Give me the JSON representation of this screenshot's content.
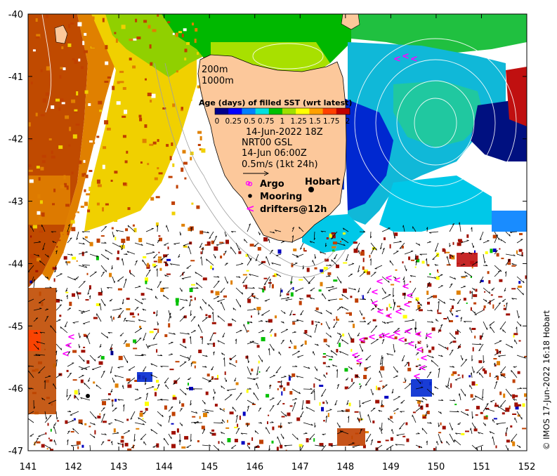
{
  "map": {
    "lon_ticks": [
      "141",
      "142",
      "143",
      "144",
      "145",
      "146",
      "147",
      "148",
      "149",
      "150",
      "151",
      "152"
    ],
    "lat_ticks": [
      "-40",
      "-41",
      "-42",
      "-43",
      "-44",
      "-45",
      "-46",
      "-47"
    ],
    "lon_range": [
      141,
      152
    ],
    "lat_range": [
      -47,
      -40
    ]
  },
  "isobaths": {
    "label_200": "200m",
    "label_1000": "1000m"
  },
  "colorbar": {
    "title": "Age (days) of filled SST (wrt latest)",
    "ticks": [
      "0",
      "0.25",
      "0.5",
      "0.75",
      "1",
      "1.25",
      "1.5",
      "1.75",
      "2"
    ],
    "colors": [
      "#00008b",
      "#0000ff",
      "#0080ff",
      "#00e0e0",
      "#00c000",
      "#a0e000",
      "#ffff00",
      "#ffa000",
      "#ff4000",
      "#c00000"
    ]
  },
  "annotations": {
    "sst_time": "14-Jun-2022 18Z",
    "current_source": "NRT00 GSL",
    "current_time": "14-Jun 06:00Z",
    "scale_text": "0.5m/s (1kt 24h)"
  },
  "legend": {
    "argo": "Argo",
    "mooring": "Mooring",
    "drifters": "drifters@12h",
    "argo_symbol": "o",
    "mooring_symbol": "●",
    "drifter_symbol": "<"
  },
  "places": {
    "hobart": "Hobart"
  },
  "credit": "© IMOS 17-Jun-2022 16:18 Hobart",
  "colors": {
    "land": "#fcc89b",
    "argo": "#ff00ff",
    "drifter": "#ff00ff",
    "mooring": "#000000"
  }
}
